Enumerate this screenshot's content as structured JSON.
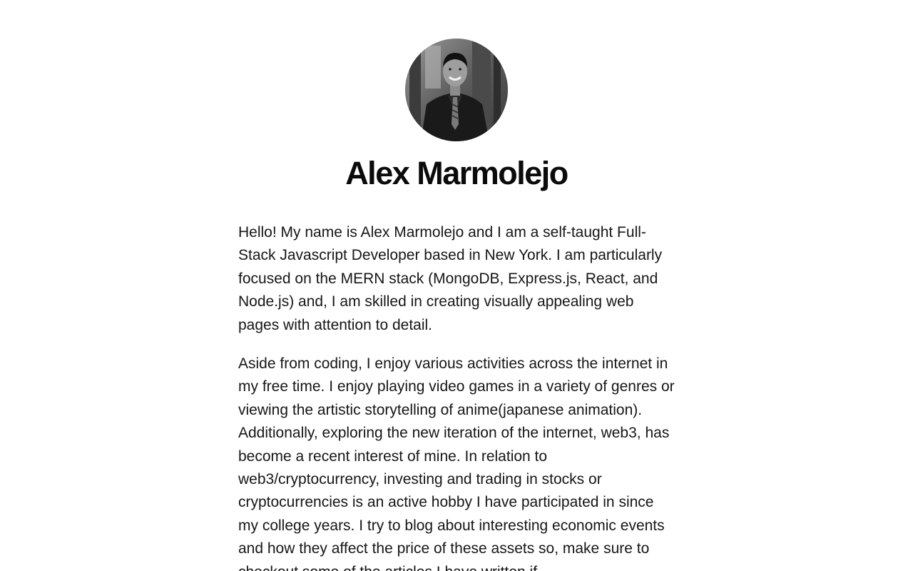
{
  "profile": {
    "name": "Alex Marmolejo",
    "photo_icon": "profile-photo"
  },
  "bio": {
    "paragraph_1": "Hello! My name is Alex Marmolejo and I am a self-taught Full-Stack Javascript Developer based in New York. I am particularly focused on the MERN stack (MongoDB, Express.js, React, and Node.js) and, I am skilled in creating visually appealing web pages with attention to detail.",
    "paragraph_2": "Aside from coding, I enjoy various activities across the internet in my free time. I enjoy playing video games in a variety of genres or viewing the artistic storytelling of anime(japanese animation). Additionally, exploring the new iteration of the internet, web3, has become a recent interest of mine. In relation to web3/cryptocurrency, investing and trading in stocks or cryptocurrencies is an active hobby I have participated in since my college years. I try to blog about interesting economic events and how they affect the price of these assets so, make sure to checkout some of the articles I have written if"
  },
  "colors": {
    "background": "#ffffff",
    "text": "#111111"
  }
}
